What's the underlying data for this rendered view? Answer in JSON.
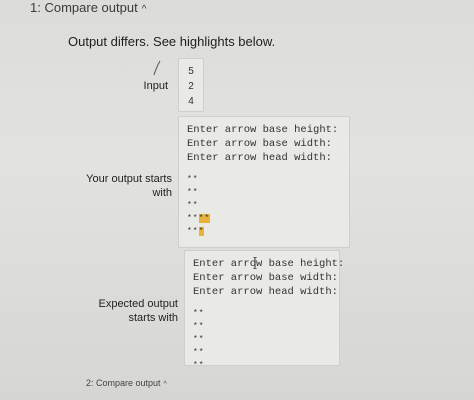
{
  "header": {
    "title": "1: Compare output",
    "caret": "^"
  },
  "summary": "Output differs. See highlights below.",
  "input_section": {
    "label": "Input",
    "values": [
      "5",
      "2",
      "4"
    ]
  },
  "your_output": {
    "label_line1": "Your output starts",
    "label_line2": "with",
    "prompts": [
      "Enter arrow base height:",
      "Enter arrow base width:",
      "Enter arrow head width:"
    ],
    "stars": [
      "**",
      "**",
      "**",
      "****",
      "***"
    ]
  },
  "expected_output": {
    "label_line1": "Expected output",
    "label_line2": "starts with",
    "prompts": [
      "Enter arrow base height:",
      "Enter arrow base width:",
      "Enter arrow head width:"
    ],
    "stars": [
      "**",
      "**",
      "**",
      "**",
      "**"
    ]
  },
  "footer": {
    "title": "2: Compare output",
    "caret": "^"
  },
  "colors": {
    "highlight": "#e9b23a",
    "panel_bg": "#e9e9e6"
  }
}
